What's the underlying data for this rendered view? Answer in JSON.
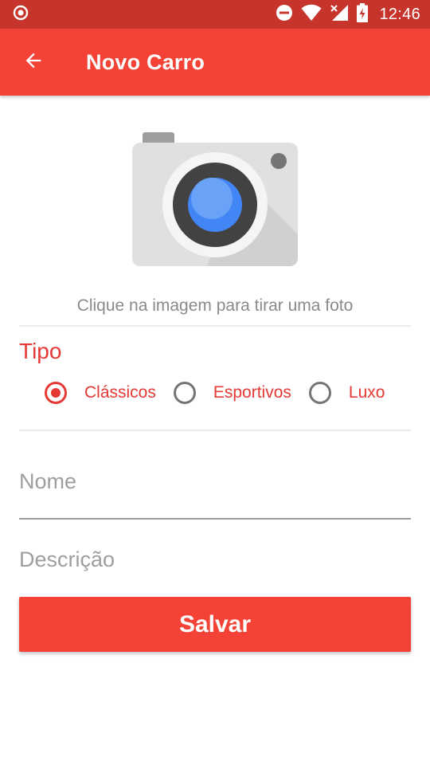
{
  "status_bar": {
    "time": "12:46",
    "icons": [
      "camera-dot-icon",
      "do-not-disturb-icon",
      "wifi-icon",
      "signal-no-data-icon",
      "battery-charging-icon"
    ]
  },
  "app_bar": {
    "title": "Novo Carro",
    "back_icon": "arrow-back-icon",
    "color": "#f44336"
  },
  "photo": {
    "icon": "camera-icon",
    "hint": "Clique na imagem para tirar uma foto"
  },
  "tipo": {
    "label": "Tipo",
    "options": [
      {
        "label": "Clássicos",
        "selected": true
      },
      {
        "label": "Esportivos",
        "selected": false
      },
      {
        "label": "Luxo",
        "selected": false
      }
    ]
  },
  "form": {
    "nome_placeholder": "Nome",
    "nome_value": "",
    "descricao_placeholder": "Descrição",
    "descricao_value": ""
  },
  "actions": {
    "save_label": "Salvar"
  },
  "colors": {
    "accent": "#f44336",
    "status_bar": "#c6342c",
    "text_accent": "#e53935"
  }
}
